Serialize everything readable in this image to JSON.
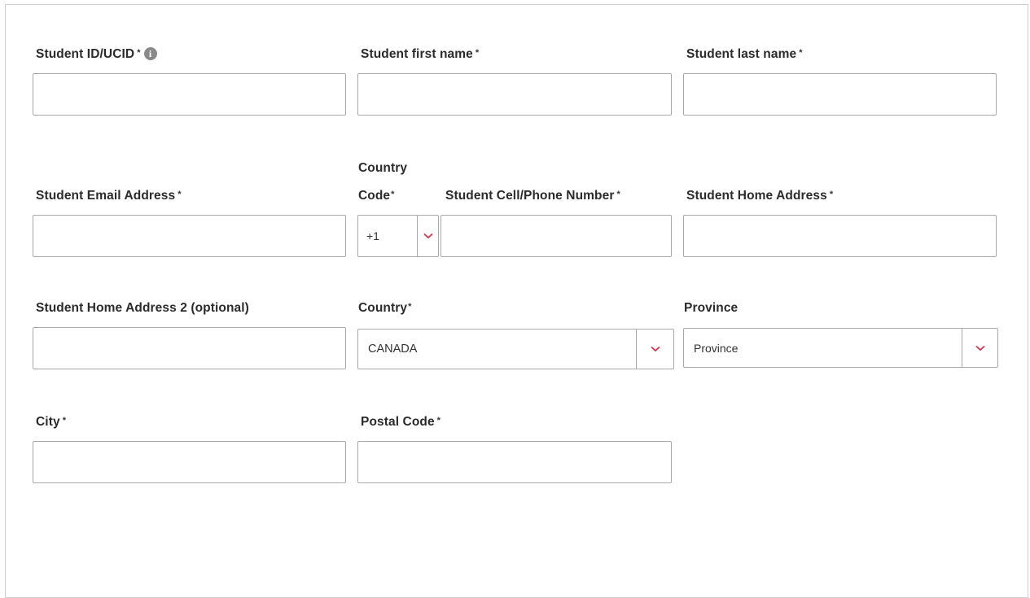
{
  "form": {
    "required_mark": "*",
    "student_id": {
      "label": "Student ID/UCID",
      "info_icon": "info-icon",
      "value": ""
    },
    "first_name": {
      "label": "Student first name",
      "value": ""
    },
    "last_name": {
      "label": "Student last name",
      "value": ""
    },
    "email": {
      "label": "Student Email Address",
      "value": ""
    },
    "country_code": {
      "label_line1": "Country",
      "label_line2": "Code",
      "value": "+1"
    },
    "phone": {
      "label": "Student Cell/Phone Number",
      "value": ""
    },
    "home_address": {
      "label": "Student Home Address",
      "value": ""
    },
    "home_address2": {
      "label": "Student Home Address 2 (optional)",
      "value": ""
    },
    "country": {
      "label": "Country",
      "value": "CANADA"
    },
    "province": {
      "label": "Province",
      "value": "Province"
    },
    "city": {
      "label": "City",
      "value": ""
    },
    "postal_code": {
      "label": "Postal Code",
      "value": ""
    }
  },
  "colors": {
    "chevron": "#d2334a",
    "border": "#a9a9a9",
    "label": "#2b2b2b"
  }
}
